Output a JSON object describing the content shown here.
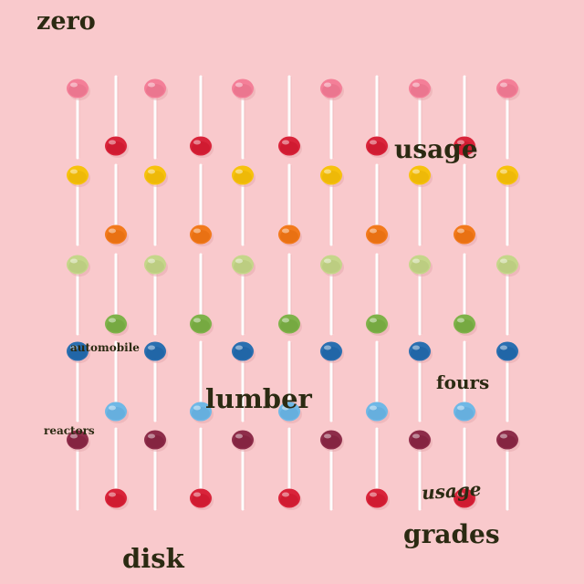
{
  "photo": {
    "subject": "lollipops",
    "background_color": "#f9c9cc",
    "stick_color": "#fdfdfd",
    "candy_colors": {
      "pink": "#f47f98",
      "red": "#d9243a",
      "yellow": "#f7c20d",
      "orange": "#f27a1c",
      "light_green": "#c5d68a",
      "green": "#7fb24a",
      "blue": "#2a6fb0",
      "light_blue": "#6fb8e6",
      "maroon": "#8e2d4a"
    },
    "row_colors": [
      "pink",
      "red",
      "yellow",
      "orange",
      "light_green",
      "green",
      "blue",
      "light_blue",
      "maroon",
      "red"
    ]
  },
  "words": {
    "zero": "zero",
    "usage_top": "usage",
    "automobile": "automobile",
    "fours": "fours",
    "lumber": "lumber",
    "reactors": "reactors",
    "usage_bottom": "usage",
    "grades": "grades",
    "disk": "disk"
  }
}
